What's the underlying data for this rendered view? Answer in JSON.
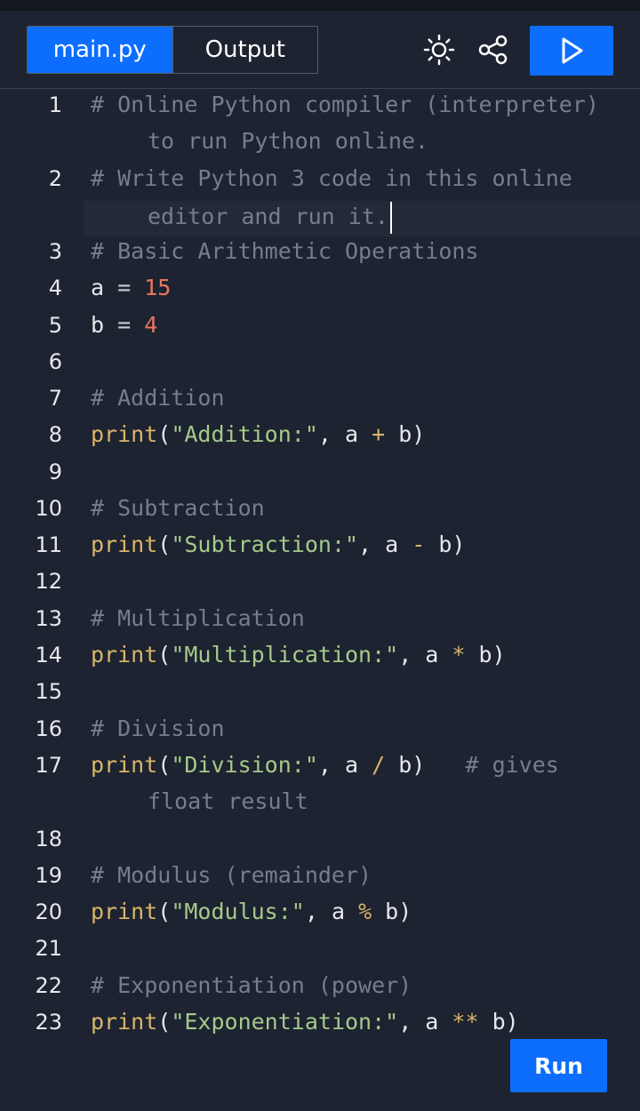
{
  "tabs": [
    {
      "label": "main.py",
      "active": true
    },
    {
      "label": "Output",
      "active": false
    }
  ],
  "header_icons": [
    "theme-sun-icon",
    "share-icon",
    "play-icon"
  ],
  "run_button": {
    "label": "Run"
  },
  "colors": {
    "accent": "#0d6efd",
    "background": "#1d2330",
    "comment": "#757e8d",
    "keyword": "#d9b56a",
    "string": "#a6c98a",
    "number": "#e8765e"
  },
  "code": {
    "line_numbers": [
      "1",
      "2",
      "3",
      "4",
      "5",
      "6",
      "7",
      "8",
      "9",
      "10",
      "11",
      "12",
      "13",
      "14",
      "15",
      "16",
      "17",
      "18",
      "19",
      "20",
      "21",
      "22",
      "23"
    ],
    "l1_a": "# Online Python compiler (interpreter)",
    "l1_b": "to run Python online.",
    "l2_a": "# Write Python 3 code in this online",
    "l2_b": "editor and run it.",
    "l3": "# Basic Arithmetic Operations",
    "l4_var": "a",
    "l4_op": "=",
    "l4_num": "15",
    "l5_var": "b",
    "l5_op": "=",
    "l5_num": "4",
    "l7": "# Addition",
    "l8_fn": "print",
    "l8_str": "\"Addition:\"",
    "l8_rest_a": ", a ",
    "l8_op": "+",
    "l8_rest_b": " b)",
    "l10": "# Subtraction",
    "l11_fn": "print",
    "l11_str": "\"Subtraction:\"",
    "l11_rest_a": ", a ",
    "l11_op": "-",
    "l11_rest_b": " b)",
    "l13": "# Multiplication",
    "l14_fn": "print",
    "l14_str": "\"Multiplication:\"",
    "l14_rest_a": ", a ",
    "l14_op": "*",
    "l14_rest_b": " b)",
    "l16": "# Division",
    "l17_fn": "print",
    "l17_str": "\"Division:\"",
    "l17_rest_a": ", a ",
    "l17_op": "/",
    "l17_rest_b": " b)",
    "l17_cmt_a": "# gives",
    "l17_cmt_b": "float result",
    "l19": "# Modulus (remainder)",
    "l20_fn": "print",
    "l20_str": "\"Modulus:\"",
    "l20_rest_a": ", a ",
    "l20_op": "%",
    "l20_rest_b": " b)",
    "l22": "# Exponentiation (power)",
    "l23_fn": "print",
    "l23_str": "\"Exponentiation:\"",
    "l23_rest_a": ", a ",
    "l23_op": "**",
    "l23_rest_b": " b)"
  }
}
